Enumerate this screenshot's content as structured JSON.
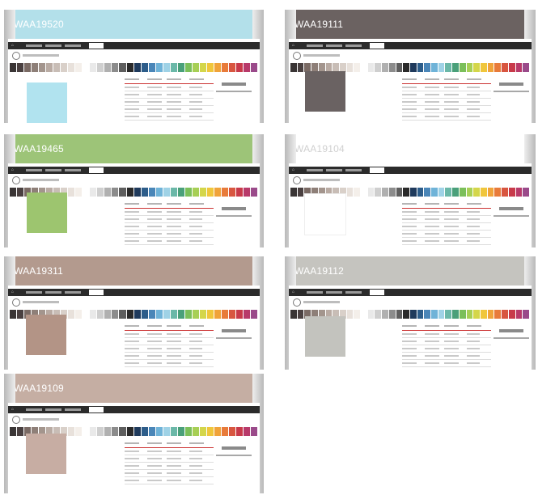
{
  "cards": [
    {
      "code": "WAA19520",
      "banner_color": "#b3e0ea",
      "swatch_color": "#b1e3ef",
      "code_color": "#ffffff"
    },
    {
      "code": "WAA19111",
      "banner_color": "#6b6261",
      "swatch_color": "#6a6262",
      "code_color": "#ffffff"
    },
    {
      "code": "WAA19465",
      "banner_color": "#9dc478",
      "swatch_color": "#9dc56f",
      "code_color": "#ffffff"
    },
    {
      "code": "WAA19104",
      "banner_color": "#ffffff",
      "swatch_color": "#ffffff",
      "code_color": "#d0d0d0"
    },
    {
      "code": "WAA19311",
      "banner_color": "#b39a8e",
      "swatch_color": "#b39486",
      "code_color": "#ffffff"
    },
    {
      "code": "WAA19112",
      "banner_color": "#c5c4bf",
      "swatch_color": "#c3c3be",
      "code_color": "#ffffff"
    },
    {
      "code": "WAA19109",
      "banner_color": "#c5aea3",
      "swatch_color": "#c7ada3",
      "code_color": "#ffffff"
    }
  ],
  "palette_colors": [
    "#3a3535",
    "#4a4040",
    "#7a6a64",
    "#8e7f78",
    "#a3958d",
    "#b9aba3",
    "#c8bdb6",
    "#d9d0c9",
    "#e8e1db",
    "#f4efea",
    "#ffffff",
    "#e9e9e9",
    "#cfcfcf",
    "#b0b0b0",
    "#8c8c8c",
    "#5e5e5e",
    "#2a2a2a",
    "#1f3a5c",
    "#2d5d8a",
    "#4a86b8",
    "#6fb3d8",
    "#9fd2e6",
    "#6bb8a8",
    "#4aa07a",
    "#7bbf5a",
    "#a7cf55",
    "#d4d64a",
    "#f0c63c",
    "#f0a33a",
    "#e87b3a",
    "#d85640",
    "#c83a4a",
    "#b83a6a",
    "#9a4a8a"
  ],
  "nav": {
    "home": "⌂",
    "sep": "›"
  }
}
